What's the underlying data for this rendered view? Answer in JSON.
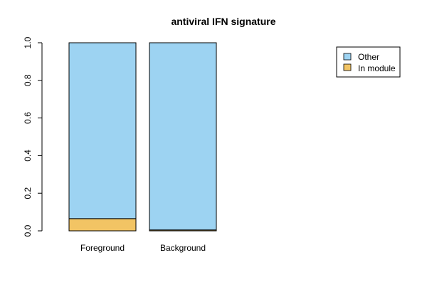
{
  "chart_data": {
    "type": "bar",
    "stacked": true,
    "title": "antiviral IFN signature",
    "xlabel": "",
    "ylabel": "",
    "categories": [
      "Foreground",
      "Background"
    ],
    "series": [
      {
        "name": "In module",
        "values": [
          0.065,
          0.005
        ],
        "color": "#F2C464"
      },
      {
        "name": "Other",
        "values": [
          0.935,
          0.995
        ],
        "color": "#9DD3F2"
      }
    ],
    "ylim": [
      0,
      1
    ],
    "yticks": [
      0.0,
      0.2,
      0.4,
      0.6,
      0.8,
      1.0
    ],
    "ytick_labels": [
      "0.0",
      "0.2",
      "0.4",
      "0.6",
      "0.8",
      "1.0"
    ],
    "legend": {
      "position": "top-right",
      "entries": [
        "Other",
        "In module"
      ]
    },
    "grid": false
  }
}
